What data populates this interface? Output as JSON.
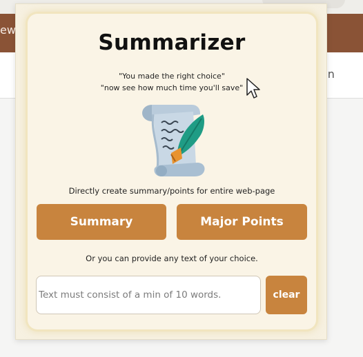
{
  "background_page": {
    "header_partial_text": "ew",
    "signin_partial_text": "In"
  },
  "popup": {
    "title": "Summarizer",
    "tagline_1": "\"You made the right choice\"",
    "tagline_2": "\"now see how much time you'll save\"",
    "illustration_icon": "scroll-quill-icon",
    "description": "Directly create summary/points for entire web-page",
    "buttons": {
      "summary": "Summary",
      "major_points": "Major Points",
      "clear": "clear"
    },
    "or_text": "Or you can provide any text of your choice.",
    "text_input": {
      "placeholder": "Text must consist of a min of 10 words.",
      "value": ""
    }
  },
  "colors": {
    "accent": "#c8843e",
    "header_brown": "#8a5336",
    "popup_bg": "#faf4e6",
    "quill_green": "#20a08a",
    "scroll_blue": "#b6c9d9"
  }
}
